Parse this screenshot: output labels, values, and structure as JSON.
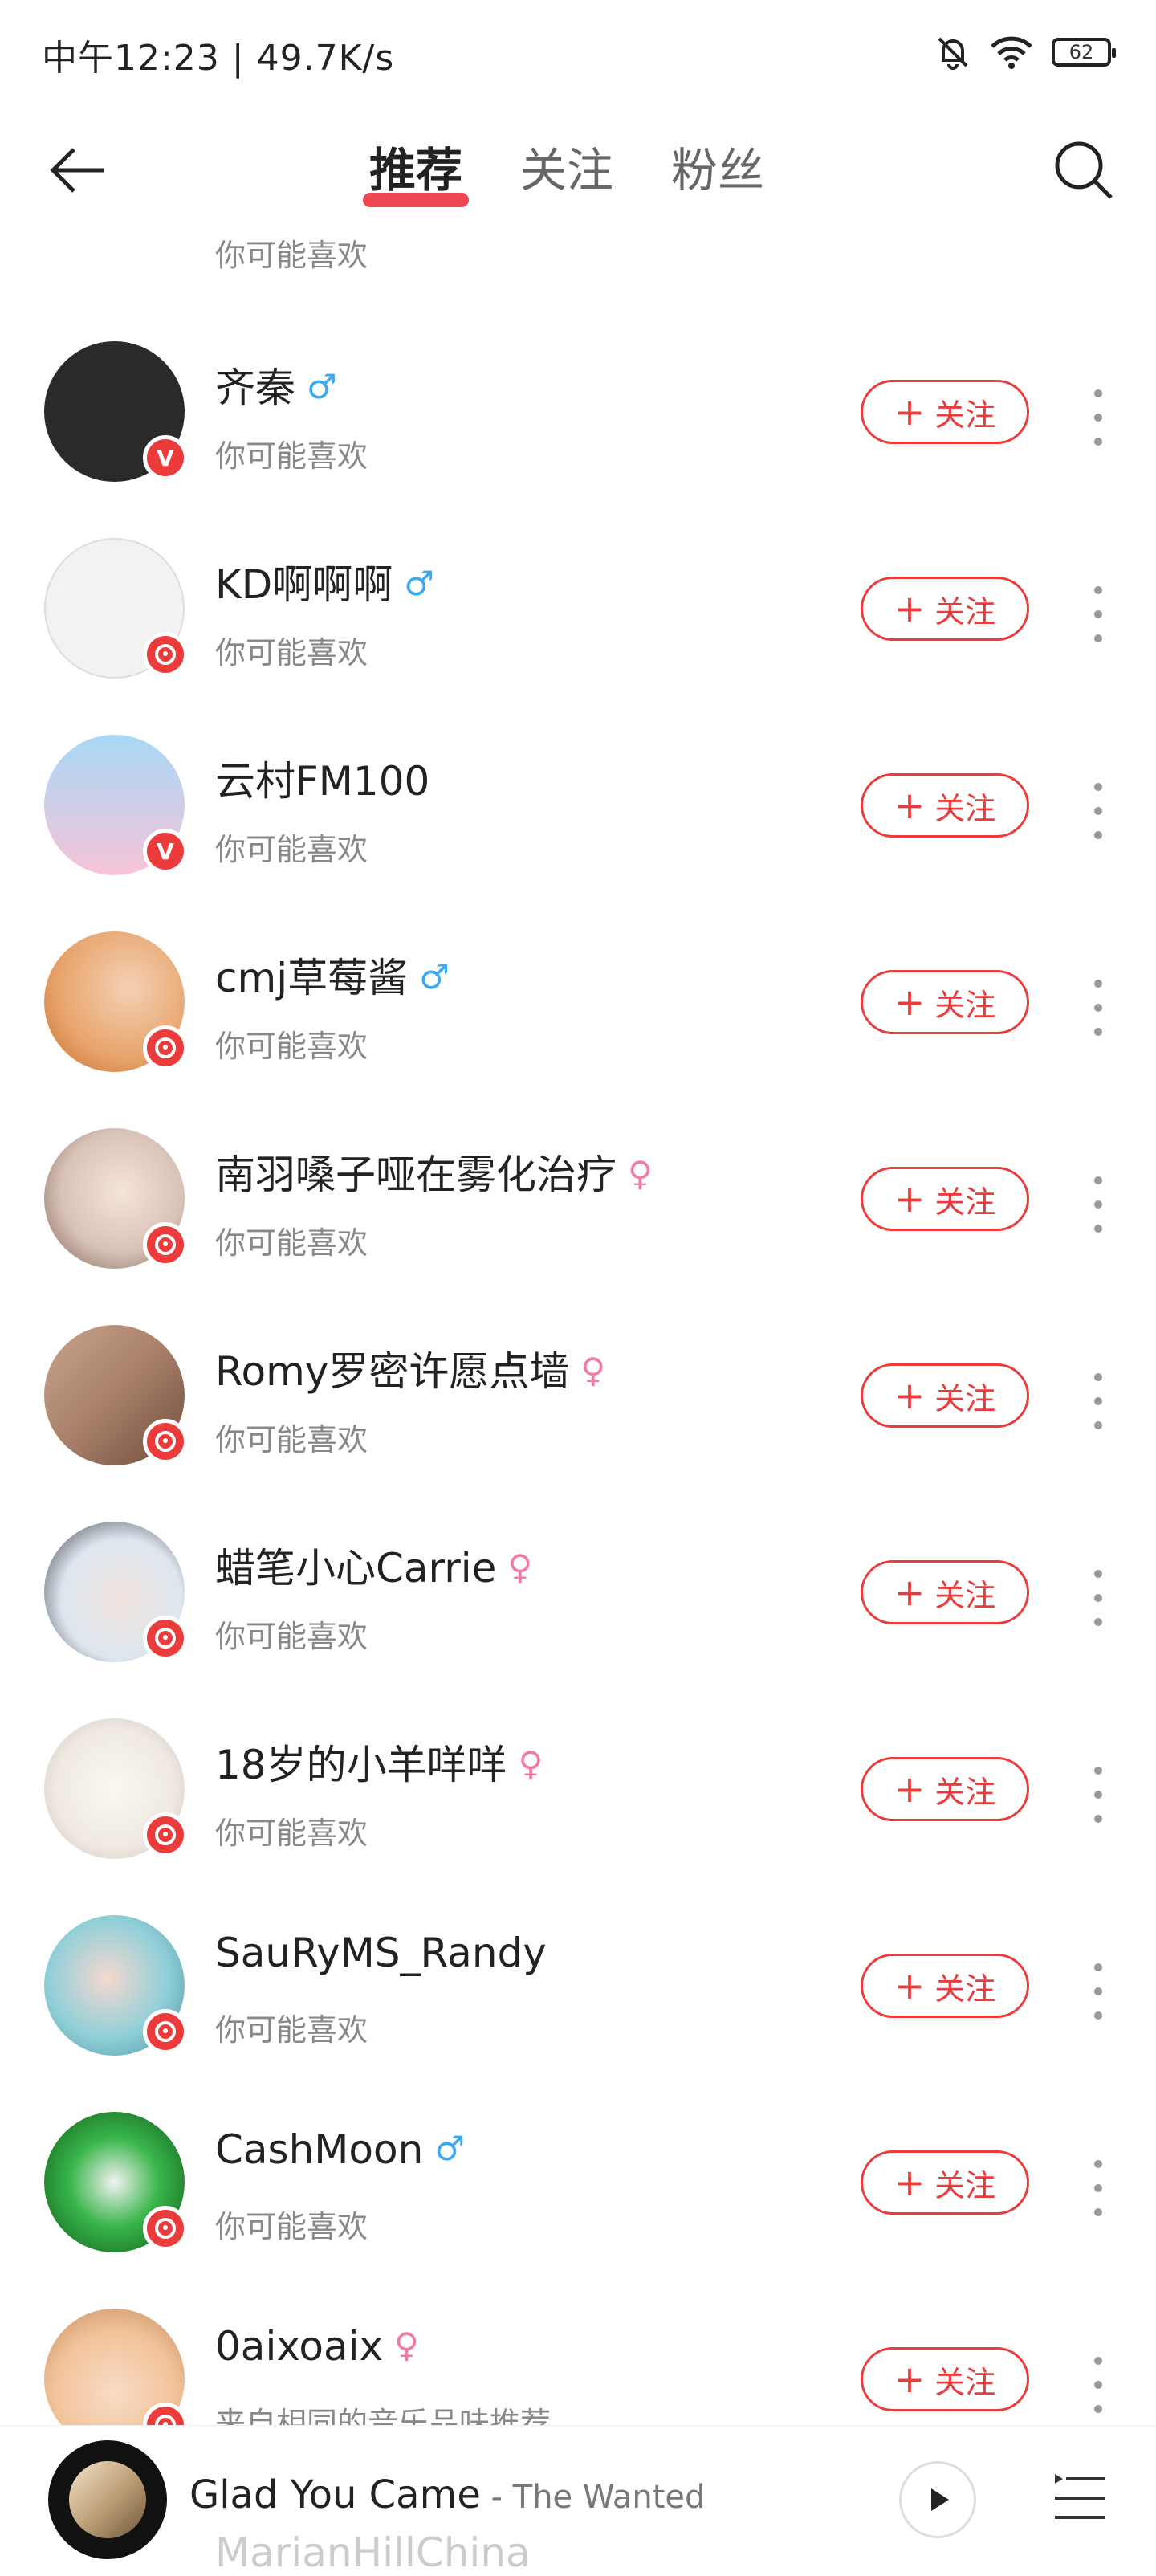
{
  "status_bar": {
    "time": "中午12:23 | 49.7K/s",
    "battery": "62"
  },
  "nav": {
    "tabs": [
      {
        "label": "推荐",
        "active": true
      },
      {
        "label": "关注",
        "active": false
      },
      {
        "label": "粉丝",
        "active": false
      }
    ]
  },
  "follow_label": "关注",
  "partial_top": {
    "subtitle": "你可能喜欢"
  },
  "users": [
    {
      "name": "齐秦",
      "gender": "male",
      "subtitle": "你可能喜欢",
      "badge": "V",
      "avatar_color": "#2a2a2a"
    },
    {
      "name": "KD啊啊啊",
      "gender": "male",
      "subtitle": "你可能喜欢",
      "badge": "music",
      "avatar_color": "#f2f2f2"
    },
    {
      "name": "云村FM100",
      "gender": "",
      "subtitle": "你可能喜欢",
      "badge": "V",
      "avatar_color": "#a7d8f5"
    },
    {
      "name": "cmj草莓酱",
      "gender": "male",
      "subtitle": "你可能喜欢",
      "badge": "music",
      "avatar_color": "#e8a36a"
    },
    {
      "name": "南羽嗓子哑在雾化治疗",
      "gender": "female",
      "subtitle": "你可能喜欢",
      "badge": "music",
      "avatar_color": "#d9c3b8"
    },
    {
      "name": "Romy罗密许愿点墙",
      "gender": "female",
      "subtitle": "你可能喜欢",
      "badge": "music",
      "avatar_color": "#a8806a"
    },
    {
      "name": "蜡笔小心Carrie",
      "gender": "female",
      "subtitle": "你可能喜欢",
      "badge": "music",
      "avatar_color": "#dde6ef"
    },
    {
      "name": "18岁的小羊咩咩",
      "gender": "female",
      "subtitle": "你可能喜欢",
      "badge": "music",
      "avatar_color": "#efe9e2"
    },
    {
      "name": "SauRyMS_Randy",
      "gender": "",
      "subtitle": "你可能喜欢",
      "badge": "music",
      "avatar_color": "#8fcfd8"
    },
    {
      "name": "CashMoon",
      "gender": "male",
      "subtitle": "你可能喜欢",
      "badge": "music",
      "avatar_color": "#39b54a"
    },
    {
      "name": "0aixoaix",
      "gender": "female",
      "subtitle": "来自相同的音乐品味推荐",
      "badge": "music",
      "avatar_color": "#f2c39a"
    }
  ],
  "mini_player": {
    "title": "Glad You Came",
    "separator": " - ",
    "artist": "The Wanted"
  },
  "peek_name": "MarianHillChina",
  "colors": {
    "accent": "#ec3b3b",
    "male": "#3aa9f2",
    "female": "#f27aa8"
  }
}
